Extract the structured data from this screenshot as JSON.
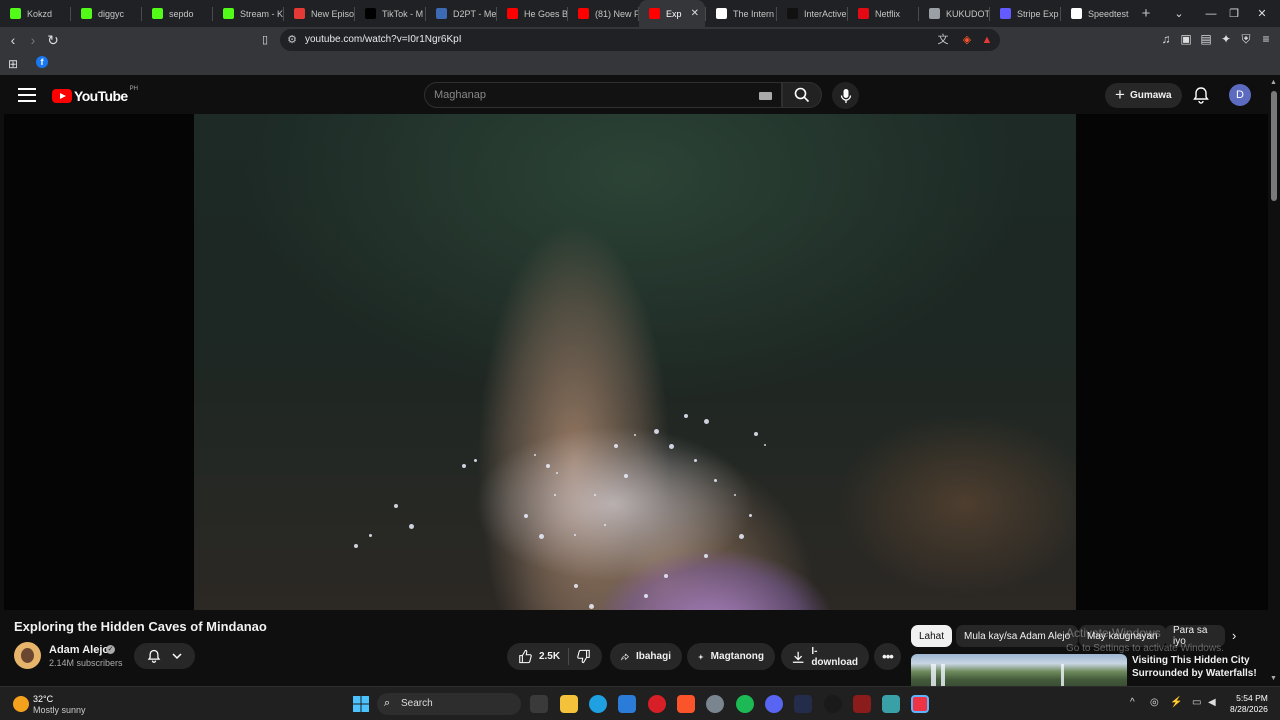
{
  "browser": {
    "tabs": [
      {
        "label": "Kokzd",
        "icon": "kick-icon",
        "color": "#53fc18"
      },
      {
        "label": "diggyc",
        "icon": "kick-icon",
        "color": "#53fc18"
      },
      {
        "label": "sepdo",
        "icon": "kick-icon",
        "color": "#53fc18"
      },
      {
        "label": "Stream - K",
        "icon": "kick-icon",
        "color": "#53fc18"
      },
      {
        "label": "New Episo",
        "icon": "anime-icon",
        "color": "#e53935"
      },
      {
        "label": "TikTok - M",
        "icon": "tiktok-icon",
        "color": "#000000"
      },
      {
        "label": "D2PT - Me",
        "icon": "d2pt-icon",
        "color": "#3d6bb3"
      },
      {
        "label": "He Goes B",
        "icon": "youtube-icon",
        "color": "#ff0000"
      },
      {
        "label": "(81) New F",
        "icon": "youtube-icon",
        "color": "#ff0000"
      },
      {
        "label": "Exp",
        "icon": "youtube-icon",
        "color": "#ff0000",
        "active": true
      },
      {
        "label": "The Intern",
        "icon": "archive-icon",
        "color": "#ffffff"
      },
      {
        "label": "InterActive",
        "icon": "interactive-icon",
        "color": "#111111"
      },
      {
        "label": "Netflix",
        "icon": "netflix-icon",
        "color": "#e50914"
      },
      {
        "label": "KUKUDOT",
        "icon": "globe-icon",
        "color": "#9aa0a6"
      },
      {
        "label": "Stripe Exp",
        "icon": "stripe-icon",
        "color": "#635bff"
      },
      {
        "label": "Speedtest",
        "icon": "speedtest-icon",
        "color": "#ffffff"
      }
    ],
    "url": "youtube.com/watch?v=I0r1Ngr6KpI"
  },
  "yt": {
    "logo_text": "YouTube",
    "country": "PH",
    "search_placeholder": "Maghanap",
    "create_label": "Gumawa",
    "avatar_letter": "D"
  },
  "video": {
    "title": "Exploring the Hidden Caves of Mindanao",
    "channel": "Adam Alejo",
    "subscribers": "2.14M subscribers",
    "likes": "2.5K",
    "share_label": "Ibahagi",
    "ask_label": "Magtanong",
    "download_label": "I-download"
  },
  "sidebar": {
    "chips": [
      "Lahat",
      "Mula kay/sa Adam Alejo",
      "May kaugnayan",
      "Para sa iyo"
    ],
    "rec_title": "Visiting This Hidden City Surrounded by Waterfalls!"
  },
  "overlay": {
    "activate_title": "Activate Windows",
    "activate_sub": "Go to Settings to activate Windows."
  },
  "taskbar": {
    "temp": "32°C",
    "weather": "Mostly sunny",
    "search_label": "Search",
    "time": "5:54 PM",
    "date": "8/28/2026"
  }
}
